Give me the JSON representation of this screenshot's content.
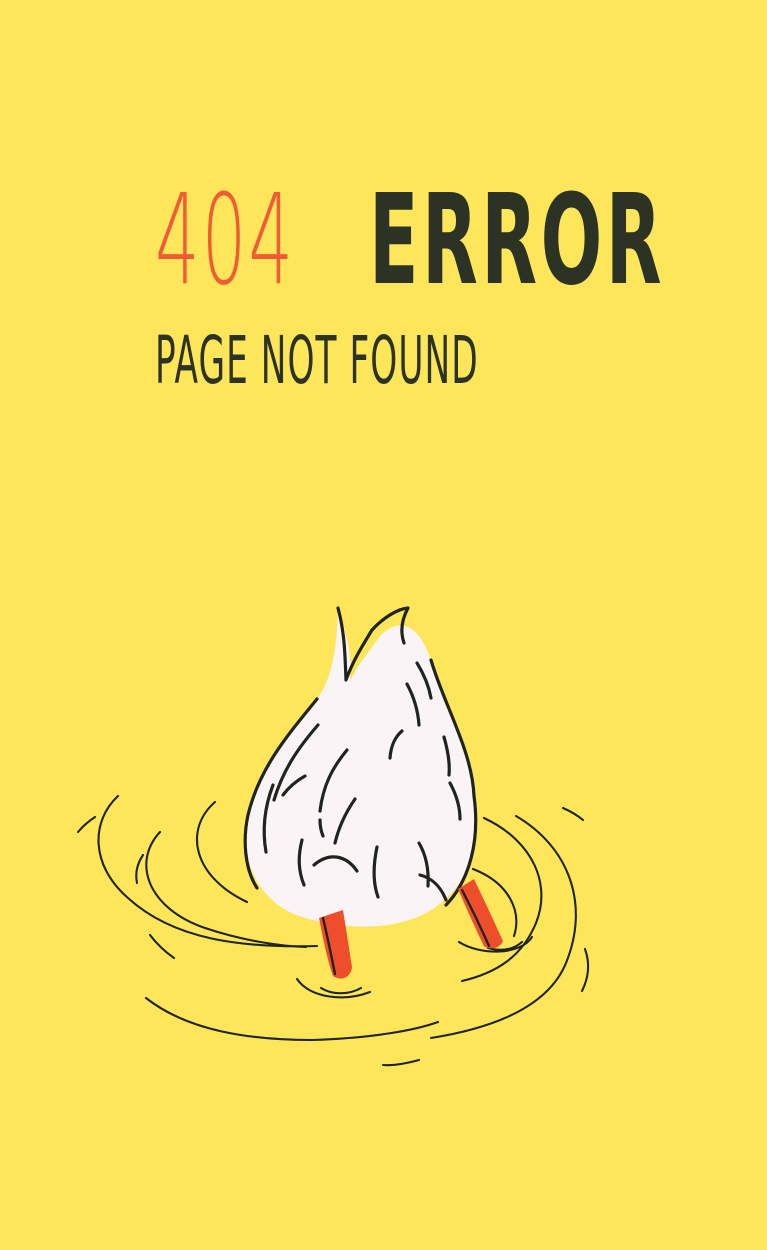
{
  "error": {
    "code": "404",
    "word": "ERROR",
    "subtitle": "PAGE NOT FOUND"
  },
  "colors": {
    "background": "#FDE65A",
    "code": "#F15B35",
    "text": "#2C3325",
    "duck_body": "#FBF4F6",
    "duck_shadow": "#F6E34A",
    "feet": "#EE4E2C",
    "ink": "#1F241E"
  },
  "illustration": {
    "icon": "diving-duck-illustration"
  }
}
